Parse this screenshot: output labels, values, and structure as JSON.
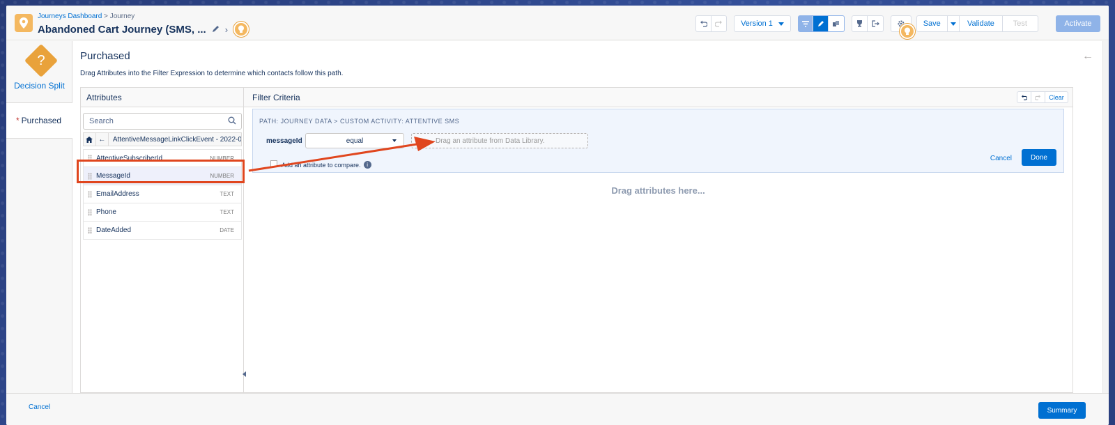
{
  "header": {
    "breadcrumb_root": "Journeys Dashboard",
    "breadcrumb_sep": " > ",
    "breadcrumb_current": "Journey",
    "title": "Abandoned Cart Journey (SMS, ...",
    "version_label": "Version 1",
    "save_label": "Save",
    "validate_label": "Validate",
    "test_label": "Test",
    "activate_label": "Activate"
  },
  "leftnav": {
    "activity_label": "Decision Split",
    "activity_icon": "question-diamond-icon",
    "path_item_required": "*",
    "path_item_label": "Purchased"
  },
  "main": {
    "title": "Purchased",
    "subtitle": "Drag Attributes into the Filter Expression to determine which contacts follow this path."
  },
  "attributes": {
    "heading": "Attributes",
    "search_placeholder": "Search",
    "path": "AttentiveMessageLinkClickEvent - 2022-0",
    "items": [
      {
        "name": "AttentiveSubscriberId",
        "type": "NUMBER"
      },
      {
        "name": "MessageId",
        "type": "NUMBER"
      },
      {
        "name": "EmailAddress",
        "type": "TEXT"
      },
      {
        "name": "Phone",
        "type": "TEXT"
      },
      {
        "name": "DateAdded",
        "type": "DATE"
      }
    ]
  },
  "filter": {
    "heading": "Filter Criteria",
    "clear_label": "Clear",
    "path_label": "PATH: JOURNEY DATA > CUSTOM ACTIVITY: ATTENTIVE SMS",
    "field_name": "messageId",
    "operator": "equal",
    "drop_placeholder": "Drag an attribute from Data Library.",
    "add_compare_label": "Add an attribute to compare.",
    "cancel_label": "Cancel",
    "done_label": "Done",
    "empty_label": "Drag attributes here..."
  },
  "footer": {
    "cancel_label": "Cancel",
    "summary_label": "Summary"
  },
  "colors": {
    "accent": "#0070d2",
    "highlight": "#e0461e",
    "activity": "#e9a23b"
  }
}
